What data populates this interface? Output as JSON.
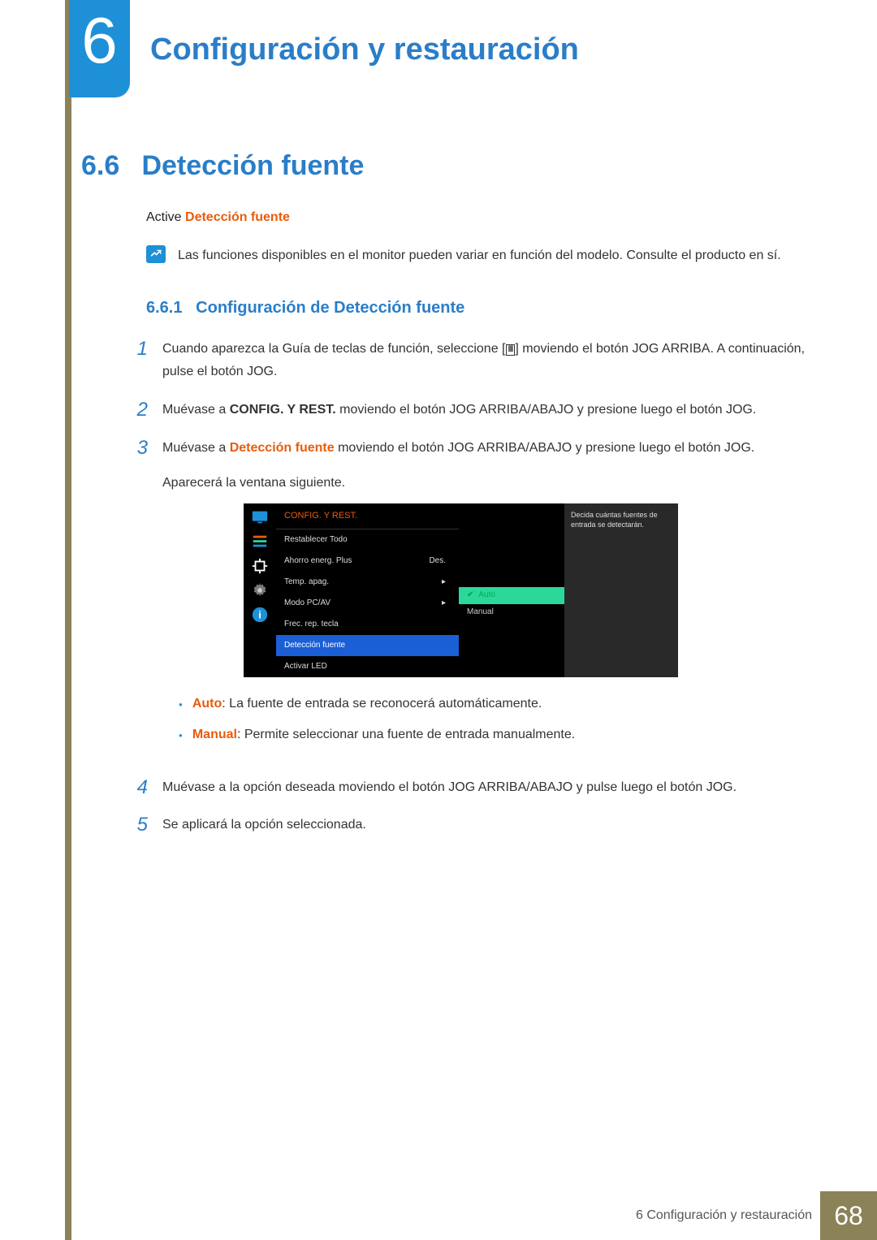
{
  "chapter": {
    "number": "6",
    "title": "Configuración y restauración"
  },
  "section": {
    "number": "6.6",
    "title": "Detección fuente"
  },
  "intro": {
    "prefix": "Active ",
    "highlight": "Detección fuente"
  },
  "note": "Las funciones disponibles en el monitor pueden variar en función del modelo. Consulte el producto en sí.",
  "subsection": {
    "number": "6.6.1",
    "title": "Configuración de Detección fuente"
  },
  "steps": {
    "s1_a": "Cuando aparezca la Guía de teclas de función, seleccione [",
    "s1_b": "] moviendo el botón JOG ARRIBA. A continuación, pulse el botón JOG.",
    "s2_a": "Muévase a ",
    "s2_bold": "CONFIG. Y REST.",
    "s2_b": " moviendo el botón JOG ARRIBA/ABAJO y presione luego el botón JOG.",
    "s3_a": "Muévase a ",
    "s3_hl": "Detección fuente",
    "s3_b": " moviendo el botón JOG ARRIBA/ABAJO y presione luego el botón JOG.",
    "s3_c": "Aparecerá la ventana siguiente.",
    "s4": "Muévase a la opción deseada moviendo el botón JOG ARRIBA/ABAJO y pulse luego el botón JOG.",
    "s5": "Se aplicará la opción seleccionada."
  },
  "osd": {
    "header": "CONFIG. Y REST.",
    "rows": [
      {
        "label": "Restablecer Todo",
        "val": ""
      },
      {
        "label": "Ahorro energ. Plus",
        "val": "Des."
      },
      {
        "label": "Temp. apag.",
        "val": "▸"
      },
      {
        "label": "Modo PC/AV",
        "val": "▸"
      },
      {
        "label": "Frec. rep. tecla",
        "val": ""
      },
      {
        "label": "Detección fuente",
        "val": "",
        "selected": true
      },
      {
        "label": "Activar LED",
        "val": ""
      }
    ],
    "options": {
      "auto": "Auto",
      "manual": "Manual"
    },
    "help": "Decida cuántas fuentes de entrada se detectarán."
  },
  "bullets": {
    "auto_label": "Auto",
    "auto_text": ": La fuente de entrada se reconocerá automáticamente.",
    "manual_label": "Manual",
    "manual_text": ": Permite seleccionar una fuente de entrada manualmente."
  },
  "footer": {
    "text": "6 Configuración y restauración",
    "pagenum": "68"
  }
}
